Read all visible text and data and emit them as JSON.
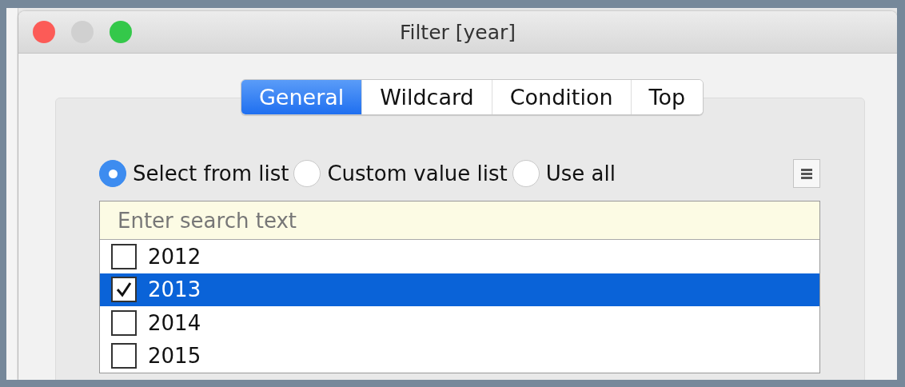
{
  "window": {
    "title": "Filter [year]"
  },
  "tabs": [
    {
      "label": "General",
      "selected": true
    },
    {
      "label": "Wildcard",
      "selected": false
    },
    {
      "label": "Condition",
      "selected": false
    },
    {
      "label": "Top",
      "selected": false
    }
  ],
  "radios": [
    {
      "label": "Select from list",
      "selected": true
    },
    {
      "label": "Custom value list",
      "selected": false
    },
    {
      "label": "Use all",
      "selected": false
    }
  ],
  "search": {
    "placeholder": "Enter search text"
  },
  "items": [
    {
      "label": "2012",
      "checked": false,
      "selected": false
    },
    {
      "label": "2013",
      "checked": true,
      "selected": true
    },
    {
      "label": "2014",
      "checked": false,
      "selected": false
    },
    {
      "label": "2015",
      "checked": false,
      "selected": false
    }
  ]
}
